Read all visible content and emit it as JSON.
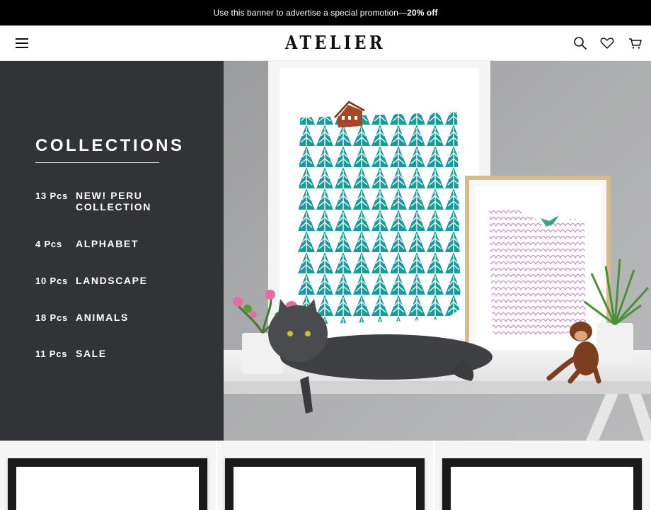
{
  "promo": {
    "text": "Use this banner to advertise a special promotion—",
    "highlight": "20% off"
  },
  "header": {
    "logo": "ATELIER",
    "menu_icon": "hamburger-menu-icon",
    "icons": [
      "search-icon",
      "heart-icon",
      "cart-icon"
    ]
  },
  "collections": {
    "title": "COLLECTIONS",
    "items": [
      {
        "count": "13 Pcs",
        "name": "NEW! PERU COLLECTION"
      },
      {
        "count": "4 Pcs",
        "name": "ALPHABET"
      },
      {
        "count": "10 Pcs",
        "name": "LANDSCAPE"
      },
      {
        "count": "18 Pcs",
        "name": "ANIMALS"
      },
      {
        "count": "11 Pcs",
        "name": "SALE"
      }
    ]
  },
  "colors": {
    "promo_bg": "#000000",
    "sidebar_bg": "#323336",
    "forest_print": "#1a9a9a",
    "cloud_print": "#c58fcc"
  }
}
